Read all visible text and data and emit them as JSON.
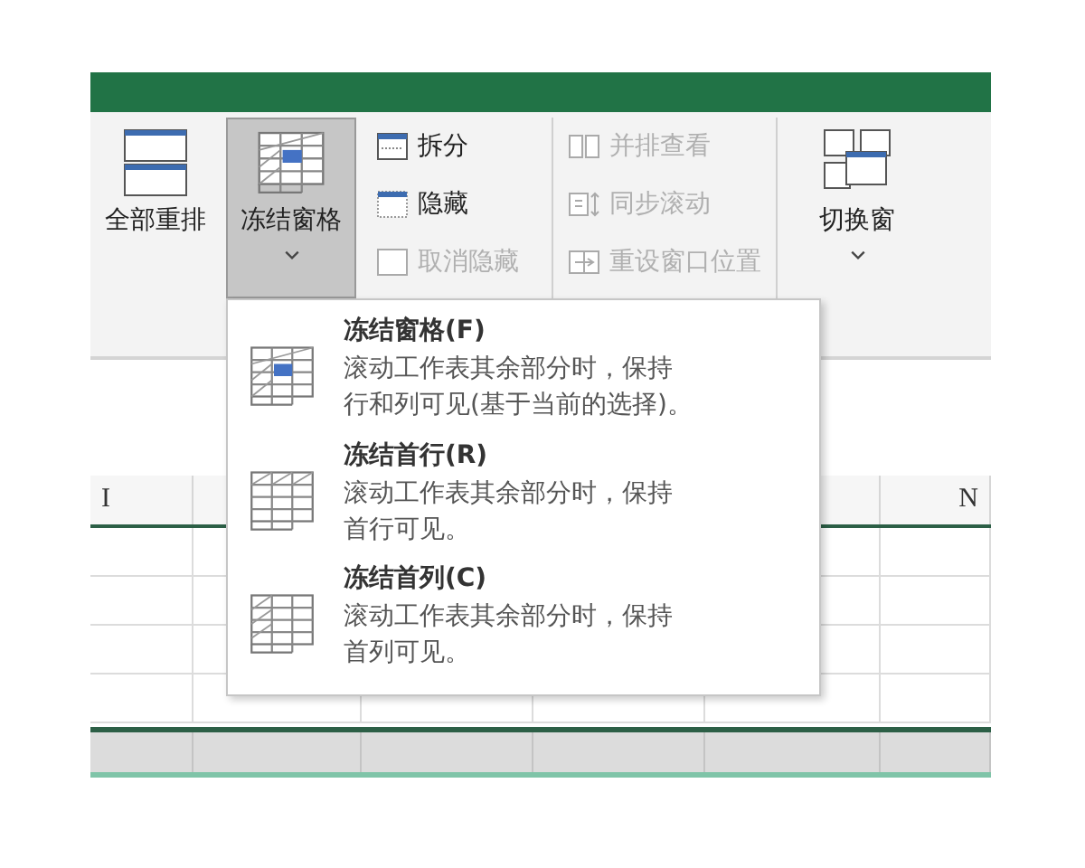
{
  "ribbon": {
    "groups": [
      {
        "kind": "large",
        "label": "全部重排",
        "selected": false,
        "dropdown": false
      },
      {
        "kind": "large",
        "label": "冻结窗格",
        "selected": true,
        "dropdown": true
      },
      {
        "kind": "small_column",
        "items": [
          {
            "label": "拆分",
            "disabled": false
          },
          {
            "label": "隐藏",
            "disabled": false
          },
          {
            "label": "取消隐藏",
            "disabled": true
          }
        ]
      },
      {
        "kind": "small_column",
        "items": [
          {
            "label": "并排查看",
            "disabled": true
          },
          {
            "label": "同步滚动",
            "disabled": true
          },
          {
            "label": "重设窗口位置",
            "disabled": true
          }
        ]
      },
      {
        "kind": "large",
        "label": "切换窗",
        "selected": false,
        "dropdown": true
      }
    ]
  },
  "sheet": {
    "column_headers": [
      "I",
      "N"
    ]
  },
  "menu": {
    "items": [
      {
        "kind": "panes",
        "title": "冻结窗格(F)",
        "description": "滚动工作表其余部分时，保持行和列可见(基于当前的选择)。"
      },
      {
        "kind": "top_row",
        "title": "冻结首行(R)",
        "description": "滚动工作表其余部分时，保持首行可见。"
      },
      {
        "kind": "first_column",
        "title": "冻结首列(C)",
        "description": "滚动工作表其余部分时，保持首列可见。"
      }
    ]
  }
}
